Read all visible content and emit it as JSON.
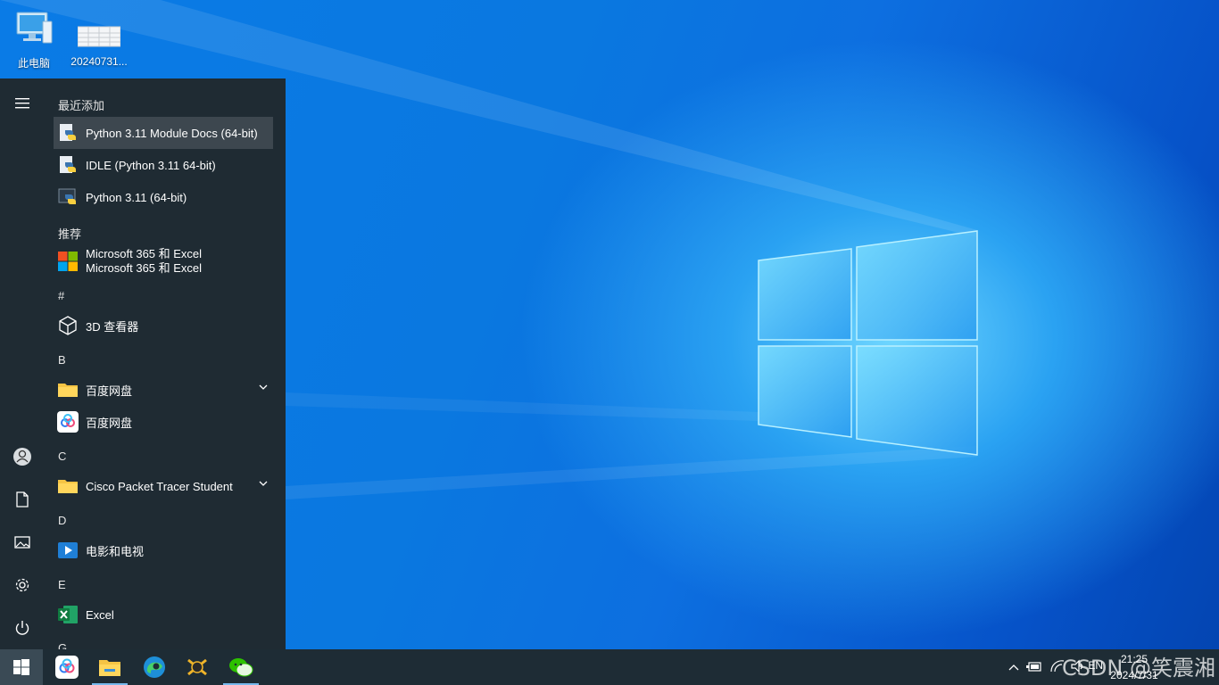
{
  "desktop": {
    "icons": [
      {
        "label": "此电脑",
        "icon": "computer-icon"
      },
      {
        "label": "20240731...",
        "icon": "spreadsheet-file-icon"
      }
    ]
  },
  "start_menu": {
    "recent_header": "最近添加",
    "recent": [
      {
        "label": "Python 3.11 Module Docs (64-bit)",
        "icon": "python-docs-icon",
        "highlighted": true
      },
      {
        "label": "IDLE (Python 3.11 64-bit)",
        "icon": "python-idle-icon"
      },
      {
        "label": "Python 3.11 (64-bit)",
        "icon": "python-icon"
      }
    ],
    "recommended_header": "推荐",
    "recommended": [
      {
        "line1": "Microsoft 365 和 Excel",
        "line2": "Microsoft 365 和 Excel",
        "icon": "microsoft-logo-icon"
      }
    ],
    "groups": [
      {
        "letter": "#",
        "items": [
          {
            "label": "3D 查看器",
            "icon": "cube-icon"
          }
        ]
      },
      {
        "letter": "B",
        "items": [
          {
            "label": "百度网盘",
            "icon": "folder-icon",
            "expandable": true
          },
          {
            "label": "百度网盘",
            "icon": "baidu-netdisk-icon"
          }
        ]
      },
      {
        "letter": "C",
        "items": [
          {
            "label": "Cisco Packet Tracer Student",
            "icon": "folder-icon",
            "expandable": true
          }
        ]
      },
      {
        "letter": "D",
        "items": [
          {
            "label": "电影和电视",
            "icon": "movies-tv-icon"
          }
        ]
      },
      {
        "letter": "E",
        "items": [
          {
            "label": "Excel",
            "icon": "excel-icon"
          }
        ]
      },
      {
        "letter": "G",
        "items": []
      }
    ],
    "rail": [
      "hamburger-icon",
      "user-icon",
      "document-icon",
      "pictures-icon",
      "settings-icon",
      "power-icon"
    ]
  },
  "taskbar": {
    "pinned": [
      "baidu-netdisk-icon",
      "file-explorer-icon",
      "edge-icon",
      "packet-tracer-icon",
      "wechat-icon"
    ],
    "tray": [
      "chevron-up-icon",
      "battery-icon",
      "network-icon",
      "volume-icon"
    ],
    "ime": "EN",
    "time": "21:25",
    "date": "2024/7/31"
  },
  "watermark": "CSDN @笑震湘",
  "colors": {
    "start_bg": "#1f2b33",
    "taskbar_bg": "#1e2c35",
    "accent": "#76b9ed"
  }
}
